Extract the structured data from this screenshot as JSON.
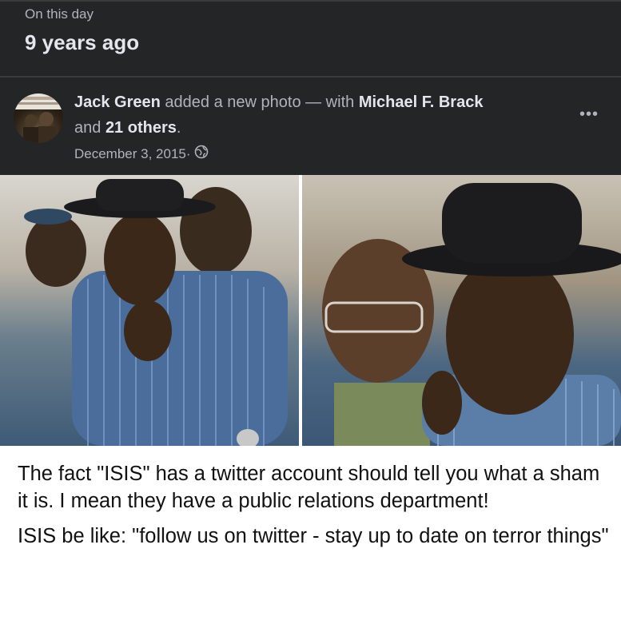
{
  "memory": {
    "label": "On this day",
    "years_ago": "9 years ago"
  },
  "post": {
    "author": "Jack Green",
    "action": " added a new photo — with ",
    "tagged": "Michael F. Brack",
    "and_text": "and ",
    "others": "21 others",
    "period": ".",
    "date": "December 3, 2015",
    "date_sep": " · ",
    "privacy_icon": "globe-icon",
    "more_label": "•••"
  },
  "photo": {
    "caption_line1": "The fact \"ISIS\" has a twitter account should tell you what a sham it is. I mean they have a public relations department!",
    "caption_line2": "ISIS be like: \"follow us on twitter - stay up to date on terror things\""
  },
  "colors": {
    "background": "#242526",
    "primary_text": "#e4e6eb",
    "secondary_text": "#b0b3b8"
  }
}
